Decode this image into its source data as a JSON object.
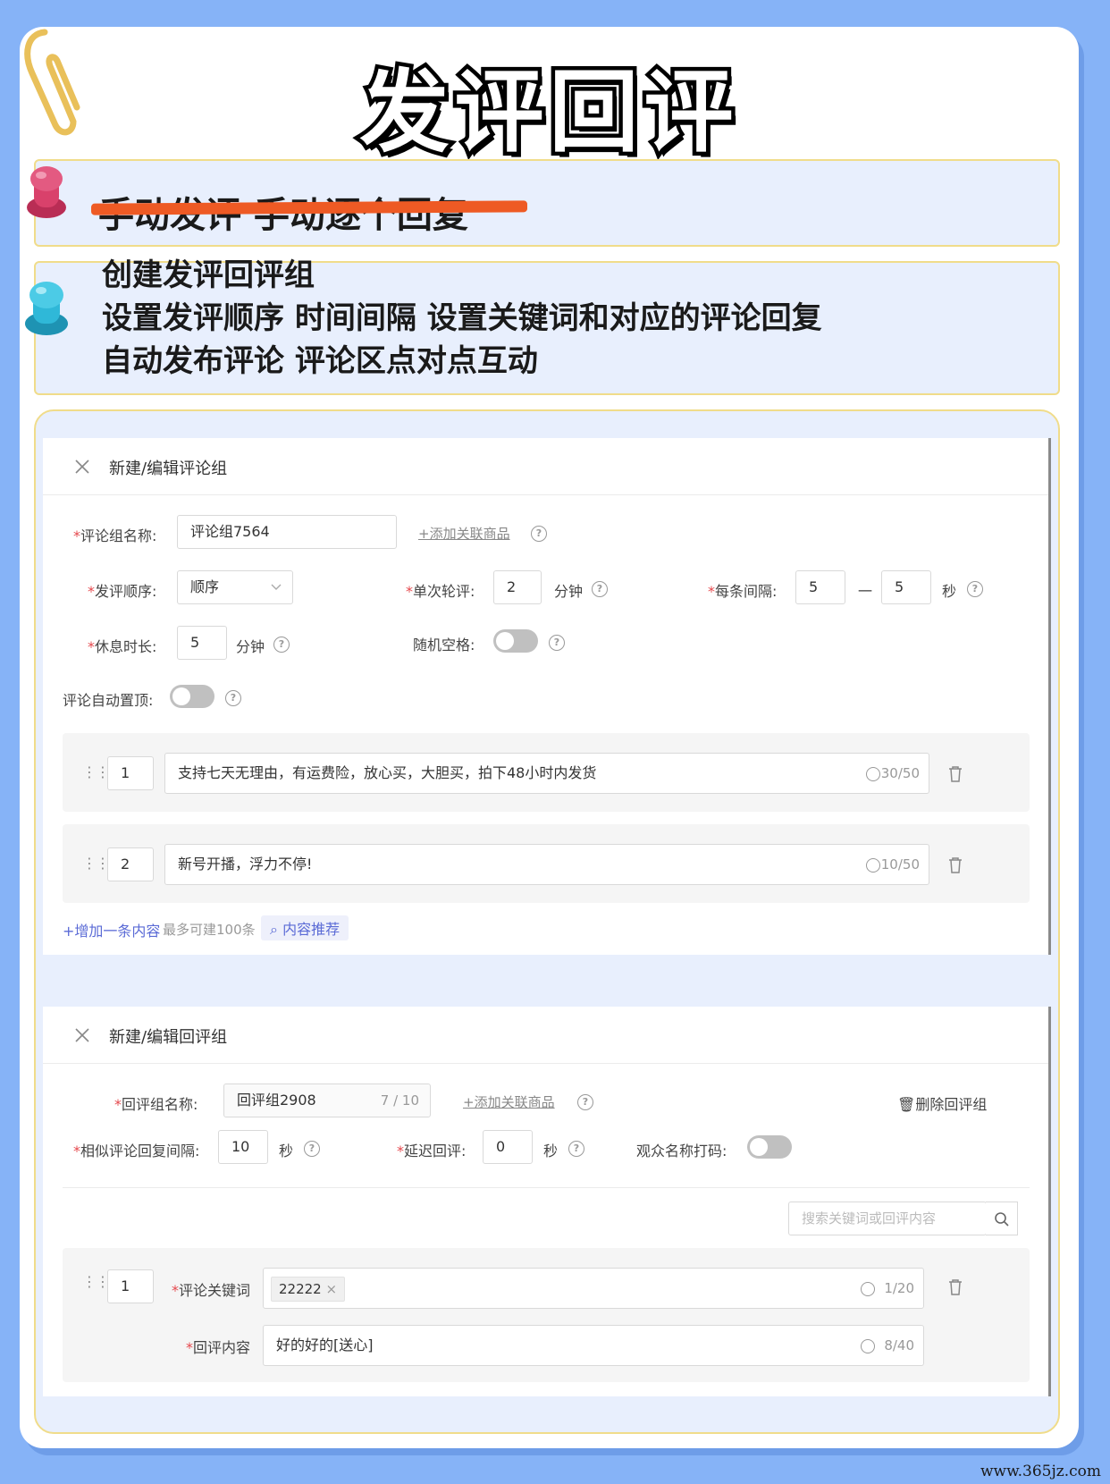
{
  "title": "发评回评",
  "banner_old": "手动发评 手动逐个回复",
  "features": [
    "创建发评回评组",
    "设置发评顺序 时间间隔 设置关键词和对应的评论回复",
    "自动发布评论 评论区点对点互动"
  ],
  "comment_panel": {
    "title": "新建/编辑评论组",
    "group_name_label": "评论组名称:",
    "group_name_value": "评论组7564",
    "add_product_link": "+添加关联商品",
    "order_label": "发评顺序:",
    "order_value": "顺序",
    "single_round_label": "单次轮评:",
    "single_round_value": "2",
    "minutes_unit": "分钟",
    "interval_label": "每条间隔:",
    "interval_min": "5",
    "interval_dash": "一",
    "interval_max": "5",
    "seconds_unit": "秒",
    "rest_label": "休息时长:",
    "rest_value": "5",
    "random_space_label": "随机空格:",
    "auto_pin_label": "评论自动置顶:",
    "items": [
      {
        "index": "1",
        "text": "支持七天无理由，有运费险，放心买，大胆买，拍下48小时内发货",
        "count": "30/50"
      },
      {
        "index": "2",
        "text": "新号开播，浮力不停!",
        "count": "10/50"
      }
    ],
    "add_item_link": "+增加一条内容",
    "add_item_hint": "最多可建100条",
    "recommend_label": "内容推荐"
  },
  "reply_panel": {
    "title": "新建/编辑回评组",
    "group_name_label": "回评组名称:",
    "group_name_value": "回评组2908",
    "group_name_count": "7 / 10",
    "add_product_link": "+添加关联商品",
    "delete_label": "删除回评组",
    "similar_interval_label": "相似评论回复间隔:",
    "similar_interval_value": "10",
    "seconds_unit": "秒",
    "delay_label": "延迟回评:",
    "delay_value": "0",
    "mask_name_label": "观众名称打码:",
    "search_placeholder": "搜索关键词或回评内容",
    "rule": {
      "index": "1",
      "keyword_label": "评论关键词",
      "keyword_tag": "22222",
      "keyword_count": "1/20",
      "reply_label": "回评内容",
      "reply_value": "好的好的[送心]",
      "reply_count": "8/40"
    }
  },
  "watermark": "www.365jz.com",
  "colors": {
    "background": "#86b3f7",
    "banner": "#e8effd",
    "strike": "#ee5a24",
    "link": "#5b6bd6",
    "required": "#e5484d",
    "pin_red": "#d9416b",
    "pin_cyan": "#2fb8d8"
  }
}
